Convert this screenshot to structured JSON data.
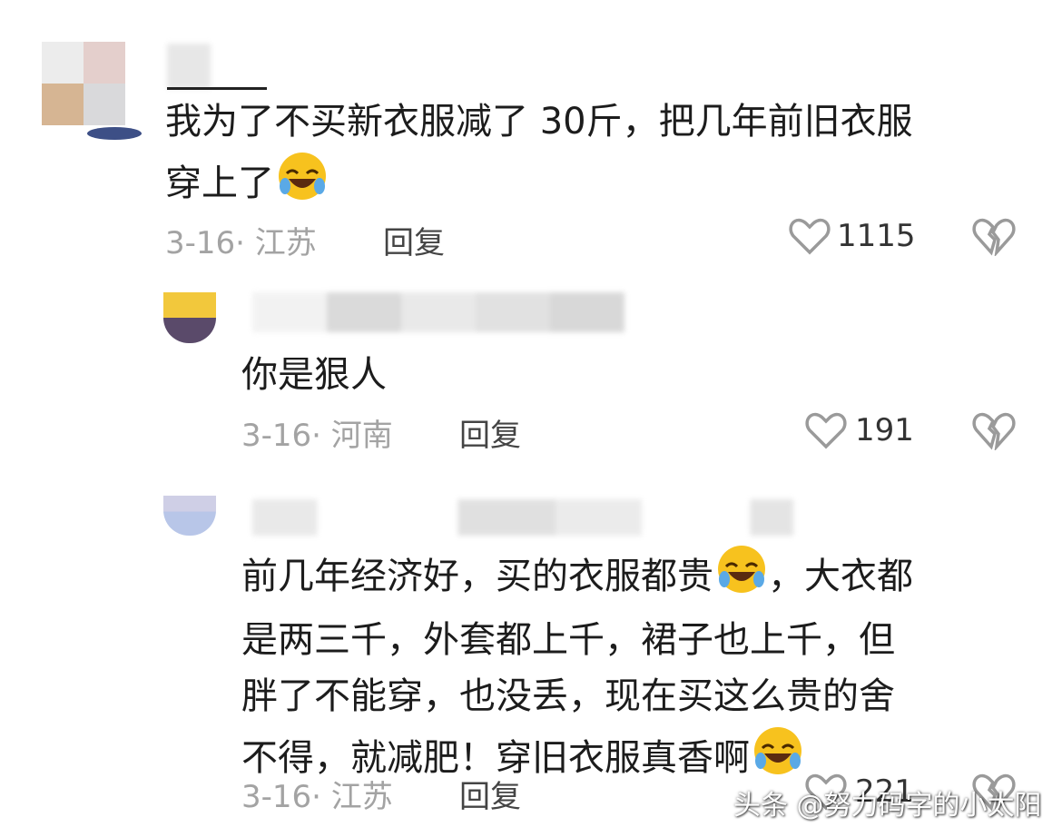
{
  "comments": [
    {
      "text_line1": "我为了不买新衣服减了 30斤，把几年前旧衣服",
      "text_line2": "穿上了",
      "date_location": "3-16· 江苏",
      "reply": "回复",
      "likes": "1115"
    },
    {
      "text_line1": "你是狠人",
      "date_location": "3-16· 河南",
      "reply": "回复",
      "likes": "191"
    },
    {
      "text_line1": "前几年经济好，买的衣服都贵",
      "text_line1b": "，大衣都",
      "text_line2": "是两三千，外套都上千，裙子也上千，但",
      "text_line3": "胖了不能穿，也没丢，现在买这么贵的舍",
      "text_line4": "不得，就减肥！穿旧衣服真香啊",
      "date_location": "3-16· 江苏",
      "reply": "回复",
      "likes": "221"
    }
  ],
  "icons": {
    "emoji": "laugh-cry-emoji",
    "like": "heart-outline-icon",
    "dislike": "broken-heart-icon"
  },
  "watermark": "头条 @努力码字的小太阳"
}
